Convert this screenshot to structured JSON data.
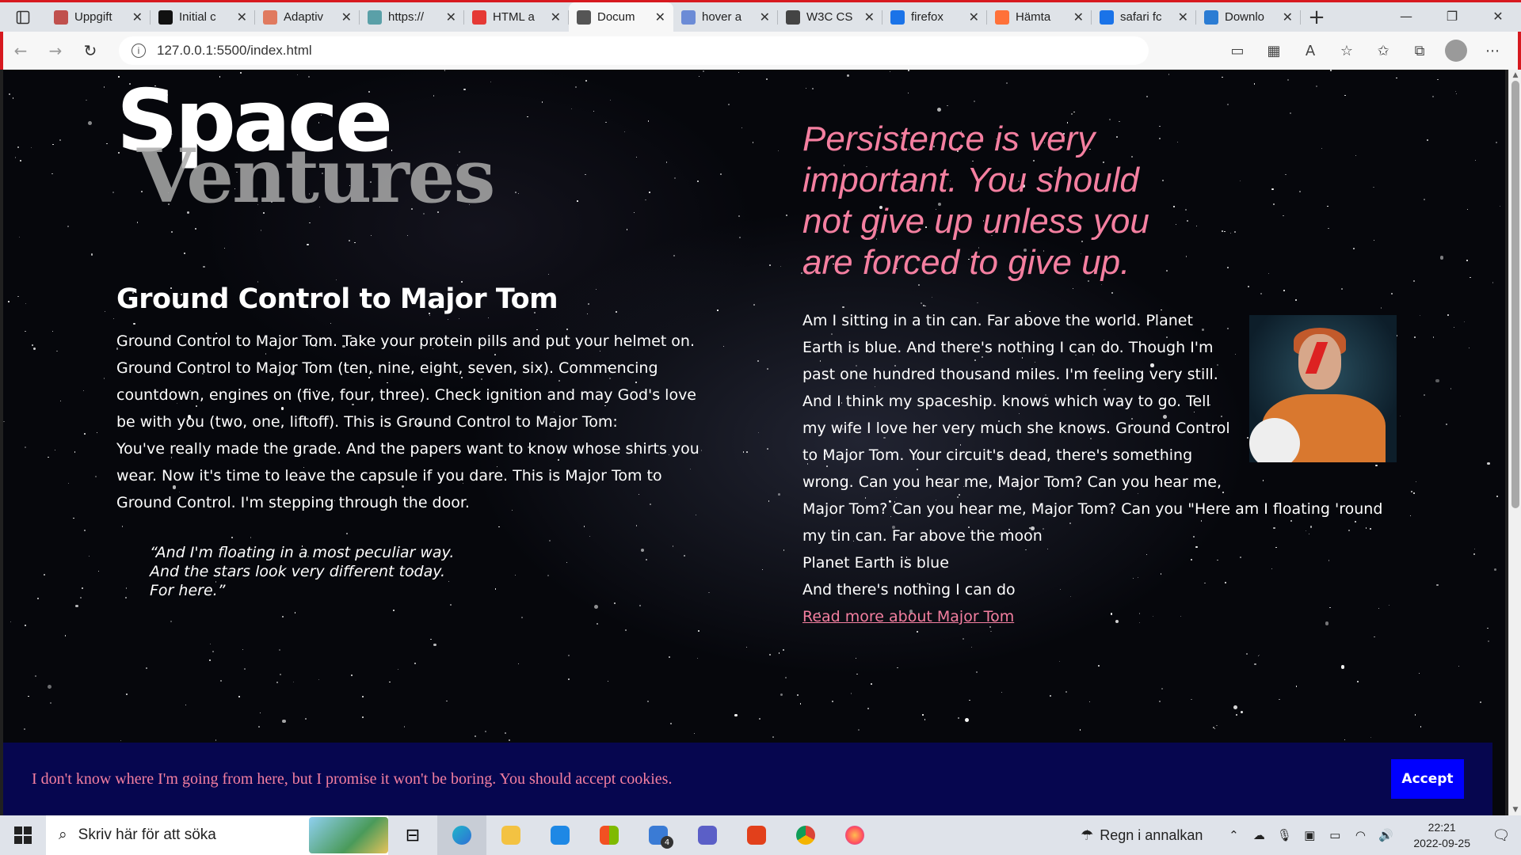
{
  "browser": {
    "tabs": [
      {
        "title": "Uppgift",
        "icon": "pin-icon",
        "color": "#c0504d",
        "active": false
      },
      {
        "title": "Initial c",
        "icon": "github-icon",
        "color": "#111111",
        "active": false
      },
      {
        "title": "Adaptiv",
        "icon": "asterisk-icon",
        "color": "#e07a5f",
        "active": false
      },
      {
        "title": "https://",
        "icon": "cloud-icon",
        "color": "#5aa0a8",
        "active": false
      },
      {
        "title": "HTML a",
        "icon": "youtube-icon",
        "color": "#e53935",
        "active": false
      },
      {
        "title": "Docum",
        "icon": "document-icon",
        "color": "#555555",
        "active": true
      },
      {
        "title": "hover a",
        "icon": "search-icon",
        "color": "#6b8bd6",
        "active": false
      },
      {
        "title": "W3C CS",
        "icon": "w3c-icon",
        "color": "#444444",
        "active": false
      },
      {
        "title": "firefox",
        "icon": "search-icon",
        "color": "#1a73e8",
        "active": false
      },
      {
        "title": "Hämta",
        "icon": "firefox-icon",
        "color": "#ff7139",
        "active": false
      },
      {
        "title": "safari fc",
        "icon": "search-icon",
        "color": "#1a73e8",
        "active": false
      },
      {
        "title": "Downlo",
        "icon": "word-icon",
        "color": "#2b7cd3",
        "active": false
      }
    ],
    "tab_close": "✕",
    "new_tab": "+",
    "url": "127.0.0.1:5500/index.html"
  },
  "page": {
    "logo": {
      "line1": "Space",
      "line2": "Ventures"
    },
    "left": {
      "heading": "Ground Control to Major Tom",
      "paragraph": "Ground Control to Major Tom. Take your protein pills and put your helmet on. Ground Control to Major Tom (ten, nine, eight, seven, six). Commencing countdown, engines on (five, four, three). Check ignition and may God's love be with you (two, one, liftoff). This is Ground Control to Major Tom:",
      "paragraph2": "You've really made the grade. And the papers want to know whose shirts you wear. Now it's time to leave the capsule if you dare. This is Major Tom to Ground Control. I'm stepping through the door.",
      "quote": "“And I'm floating in a most peculiar way.\nAnd the stars look very different today.\nFor here.”"
    },
    "right": {
      "big_quote": "Persistence is very important. You should not give up unless you are forced to give up.",
      "body": "Am I sitting in a tin can. Far above the world. Planet Earth is blue. And there's nothing I can do. Though I'm past one hundred thousand miles. I'm feeling very still. And I think my spaceship. knows which way to go. Tell my wife I love her very much she knows. Ground Control to Major Tom. Your circuit's dead, there's something wrong. Can you hear me, Major Tom? Can you hear me, Major Tom? Can you hear me, Major Tom? Can you \"Here am I floating 'round my tin can. Far above the moon",
      "line2": "Planet Earth is blue",
      "line3": "And there's nothing I can do",
      "link": "Read more about Major Tom"
    },
    "cookie": {
      "text": "I don't know where I'm going from here, but I promise it won't be boring. You should accept cookies.",
      "button": "Accept"
    }
  },
  "taskbar": {
    "search_placeholder": "Skriv här för att söka",
    "weather": "Regn i annalkan",
    "time": "22:21",
    "date": "2022-09-25",
    "mail_badge": "4"
  },
  "colors": {
    "accent_pink": "#f47fa0",
    "cookie_bg": "#06064f",
    "accept_bg": "#0000ff"
  }
}
